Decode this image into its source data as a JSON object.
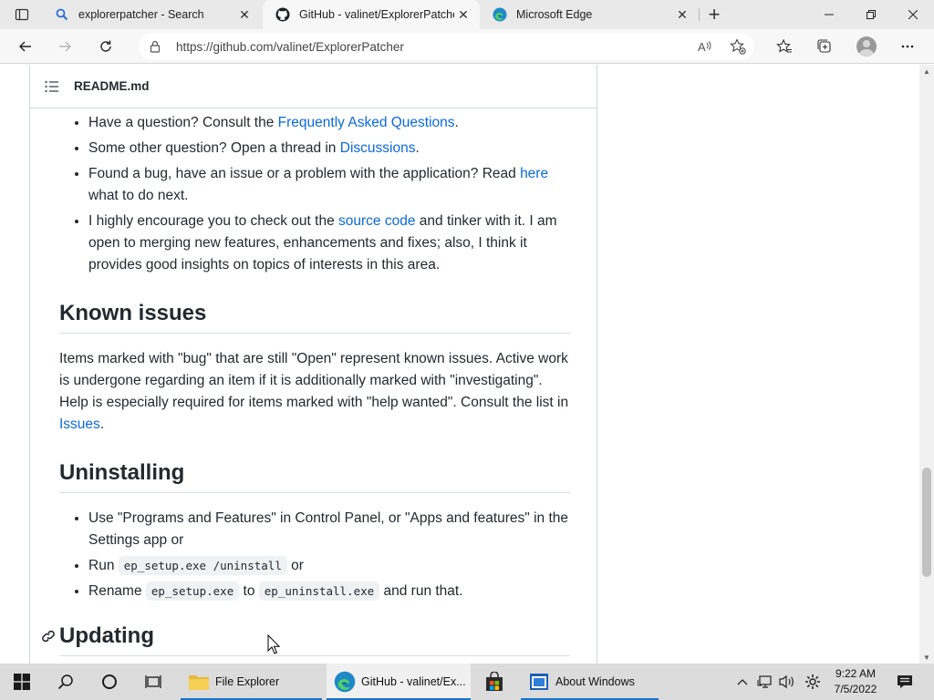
{
  "browser": {
    "tabs": [
      {
        "title": "explorerpatcher - Search",
        "favicon": "search-icon"
      },
      {
        "title": "GitHub - valinet/ExplorerPatcher",
        "favicon": "github-icon",
        "active": true
      },
      {
        "title": "Microsoft Edge",
        "favicon": "edge-icon"
      }
    ],
    "address": "https://github.com/valinet/ExplorerPatcher"
  },
  "readme": {
    "header_title": "README.md",
    "help_items": [
      {
        "pre": "Have a question? Consult the ",
        "link": "Frequently Asked Questions",
        "post": "."
      },
      {
        "pre": "Some other question? Open a thread in ",
        "link": "Discussions",
        "post": "."
      },
      {
        "pre": "Found a bug, have an issue or a problem with the application? Read ",
        "link": "here",
        "post": " what to do next."
      },
      {
        "pre": "I highly encourage you to check out the ",
        "link": "source code",
        "post": " and tinker with it. I am open to merging new features, enhancements and fixes; also, I think it provides good insights on topics of interests in this area."
      }
    ],
    "known_issues": {
      "heading": "Known issues",
      "text_pre": "Items marked with \"bug\" that are still \"Open\" represent known issues. Active work is undergone regarding an item if it is additionally marked with \"investigating\". Help is especially required for items marked with \"help wanted\". Consult the list in ",
      "link": "Issues",
      "text_post": "."
    },
    "uninstalling": {
      "heading": "Uninstalling",
      "item1": "Use \"Programs and Features\" in Control Panel, or \"Apps and features\" in the Settings app or",
      "item2_pre": "Run ",
      "item2_code": "ep_setup.exe /uninstall",
      "item2_post": " or",
      "item3_pre": "Rename ",
      "item3_code1": "ep_setup.exe",
      "item3_mid": " to ",
      "item3_code2": "ep_uninstall.exe",
      "item3_post": " and run that."
    },
    "updating_heading": "Updating"
  },
  "taskbar": {
    "apps": [
      {
        "label": "File Explorer",
        "icon": "folder-icon"
      },
      {
        "label": "GitHub - valinet/Ex...",
        "icon": "edge-icon",
        "active": true
      },
      {
        "label": "",
        "icon": "store-icon"
      },
      {
        "label": "About Windows",
        "icon": "winver-icon"
      }
    ],
    "time": "9:22 AM",
    "date": "7/5/2022"
  },
  "colors": {
    "link": "#0969da",
    "taskbar_accent": "#1a73c9"
  }
}
